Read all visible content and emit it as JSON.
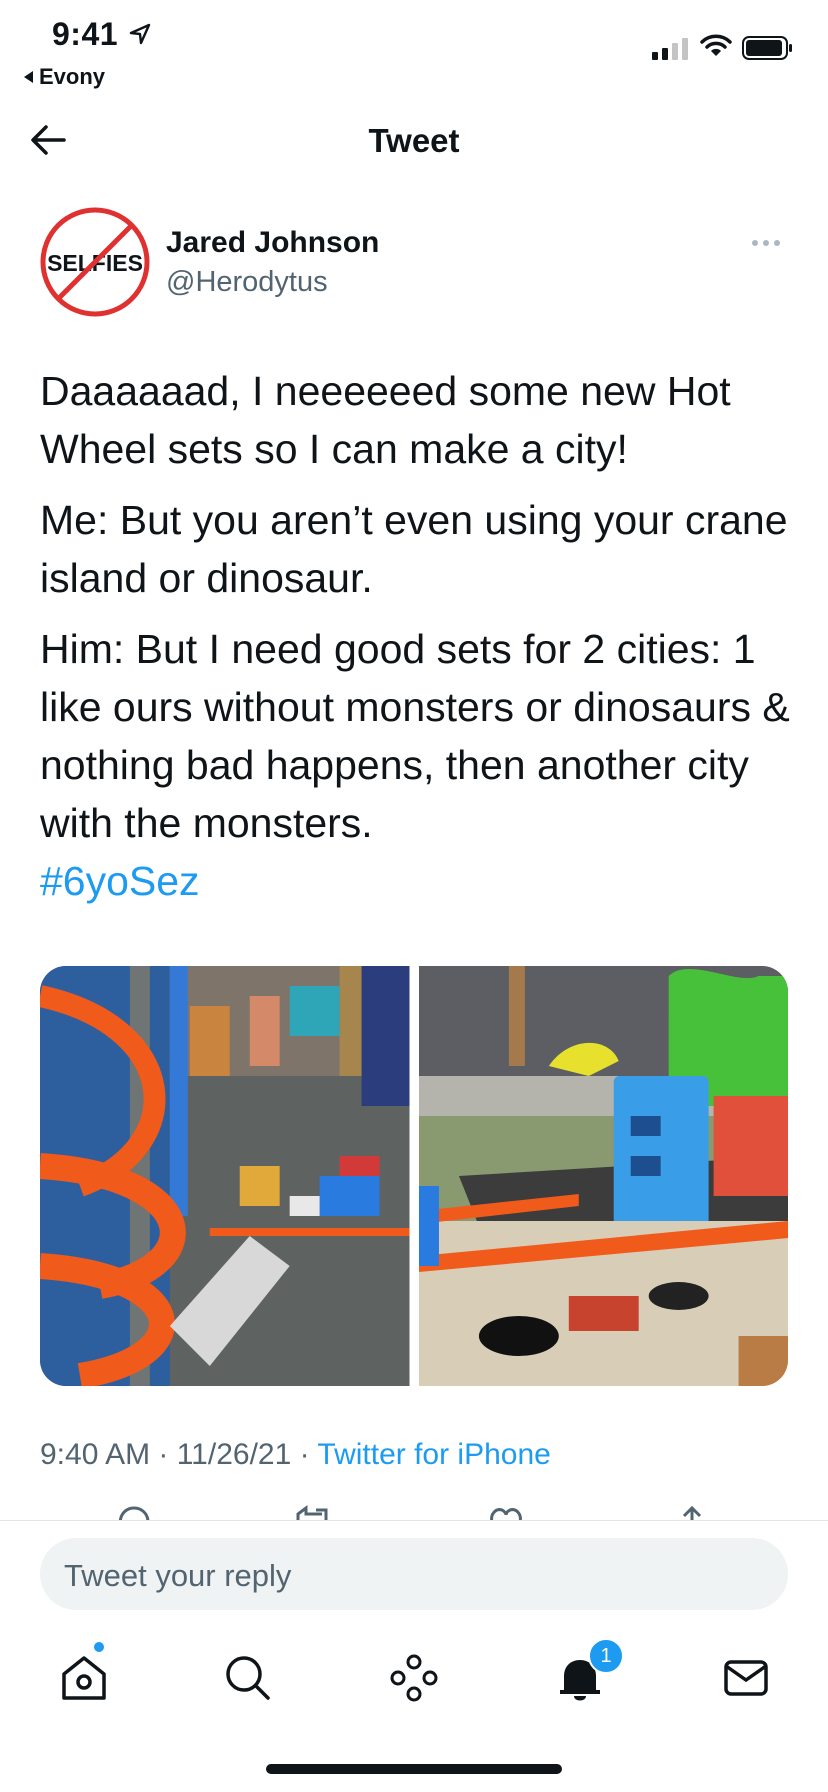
{
  "status_bar": {
    "time": "9:41",
    "back_app": "Evony"
  },
  "nav": {
    "title": "Tweet"
  },
  "tweet": {
    "avatar_text": "SELFIES",
    "author_name": "Jared Johnson",
    "author_handle": "@Herodytus",
    "paragraphs": [
      "Daaaaaad, I neeeeeed some new Hot Wheel sets so I can make a city!",
      "Me: But you aren’t even using your crane island or dinosaur.",
      "Him: But I need good sets for 2 cities: 1 like ours without monsters or dinosaurs & nothing bad happens, then another city with the monsters."
    ],
    "hashtag": "#6yoSez",
    "timestamp": "9:40 AM · 11/26/21 · ",
    "source": "Twitter for iPhone"
  },
  "reply": {
    "placeholder": "Tweet your reply"
  },
  "tab_bar": {
    "notifications_badge": "1"
  },
  "colors": {
    "accent": "#1d9bf0",
    "track_orange": "#f05a1a",
    "text_secondary": "#536471"
  }
}
